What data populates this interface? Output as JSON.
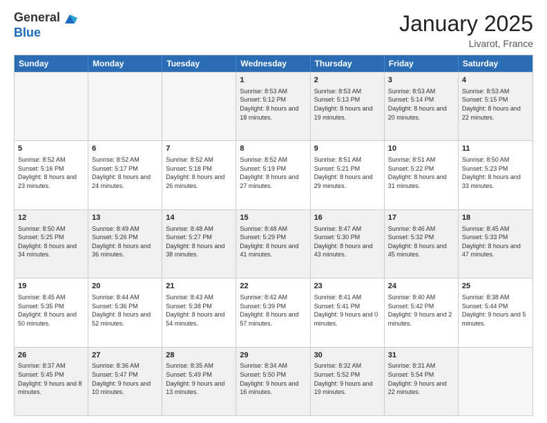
{
  "logo": {
    "general": "General",
    "blue": "Blue"
  },
  "header": {
    "month": "January 2025",
    "location": "Livarot, France"
  },
  "weekdays": [
    "Sunday",
    "Monday",
    "Tuesday",
    "Wednesday",
    "Thursday",
    "Friday",
    "Saturday"
  ],
  "weeks": [
    [
      {
        "day": "",
        "empty": true
      },
      {
        "day": "",
        "empty": true
      },
      {
        "day": "",
        "empty": true
      },
      {
        "day": "1",
        "rise": "8:53 AM",
        "set": "5:12 PM",
        "daylight": "8 hours and 18 minutes."
      },
      {
        "day": "2",
        "rise": "8:53 AM",
        "set": "5:13 PM",
        "daylight": "8 hours and 19 minutes."
      },
      {
        "day": "3",
        "rise": "8:53 AM",
        "set": "5:14 PM",
        "daylight": "8 hours and 20 minutes."
      },
      {
        "day": "4",
        "rise": "8:53 AM",
        "set": "5:15 PM",
        "daylight": "8 hours and 22 minutes."
      }
    ],
    [
      {
        "day": "5",
        "rise": "8:52 AM",
        "set": "5:16 PM",
        "daylight": "8 hours and 23 minutes."
      },
      {
        "day": "6",
        "rise": "8:52 AM",
        "set": "5:17 PM",
        "daylight": "8 hours and 24 minutes."
      },
      {
        "day": "7",
        "rise": "8:52 AM",
        "set": "5:18 PM",
        "daylight": "8 hours and 26 minutes."
      },
      {
        "day": "8",
        "rise": "8:52 AM",
        "set": "5:19 PM",
        "daylight": "8 hours and 27 minutes."
      },
      {
        "day": "9",
        "rise": "8:51 AM",
        "set": "5:21 PM",
        "daylight": "8 hours and 29 minutes."
      },
      {
        "day": "10",
        "rise": "8:51 AM",
        "set": "5:22 PM",
        "daylight": "8 hours and 31 minutes."
      },
      {
        "day": "11",
        "rise": "8:50 AM",
        "set": "5:23 PM",
        "daylight": "8 hours and 33 minutes."
      }
    ],
    [
      {
        "day": "12",
        "rise": "8:50 AM",
        "set": "5:25 PM",
        "daylight": "8 hours and 34 minutes."
      },
      {
        "day": "13",
        "rise": "8:49 AM",
        "set": "5:26 PM",
        "daylight": "8 hours and 36 minutes."
      },
      {
        "day": "14",
        "rise": "8:48 AM",
        "set": "5:27 PM",
        "daylight": "8 hours and 38 minutes."
      },
      {
        "day": "15",
        "rise": "8:48 AM",
        "set": "5:29 PM",
        "daylight": "8 hours and 41 minutes."
      },
      {
        "day": "16",
        "rise": "8:47 AM",
        "set": "5:30 PM",
        "daylight": "8 hours and 43 minutes."
      },
      {
        "day": "17",
        "rise": "8:46 AM",
        "set": "5:32 PM",
        "daylight": "8 hours and 45 minutes."
      },
      {
        "day": "18",
        "rise": "8:45 AM",
        "set": "5:33 PM",
        "daylight": "8 hours and 47 minutes."
      }
    ],
    [
      {
        "day": "19",
        "rise": "8:45 AM",
        "set": "5:35 PM",
        "daylight": "8 hours and 50 minutes."
      },
      {
        "day": "20",
        "rise": "8:44 AM",
        "set": "5:36 PM",
        "daylight": "8 hours and 52 minutes."
      },
      {
        "day": "21",
        "rise": "8:43 AM",
        "set": "5:38 PM",
        "daylight": "8 hours and 54 minutes."
      },
      {
        "day": "22",
        "rise": "8:42 AM",
        "set": "5:39 PM",
        "daylight": "8 hours and 57 minutes."
      },
      {
        "day": "23",
        "rise": "8:41 AM",
        "set": "5:41 PM",
        "daylight": "9 hours and 0 minutes."
      },
      {
        "day": "24",
        "rise": "8:40 AM",
        "set": "5:42 PM",
        "daylight": "9 hours and 2 minutes."
      },
      {
        "day": "25",
        "rise": "8:38 AM",
        "set": "5:44 PM",
        "daylight": "9 hours and 5 minutes."
      }
    ],
    [
      {
        "day": "26",
        "rise": "8:37 AM",
        "set": "5:45 PM",
        "daylight": "9 hours and 8 minutes."
      },
      {
        "day": "27",
        "rise": "8:36 AM",
        "set": "5:47 PM",
        "daylight": "9 hours and 10 minutes."
      },
      {
        "day": "28",
        "rise": "8:35 AM",
        "set": "5:49 PM",
        "daylight": "9 hours and 13 minutes."
      },
      {
        "day": "29",
        "rise": "8:34 AM",
        "set": "5:50 PM",
        "daylight": "9 hours and 16 minutes."
      },
      {
        "day": "30",
        "rise": "8:32 AM",
        "set": "5:52 PM",
        "daylight": "9 hours and 19 minutes."
      },
      {
        "day": "31",
        "rise": "8:31 AM",
        "set": "5:54 PM",
        "daylight": "9 hours and 22 minutes."
      },
      {
        "day": "",
        "empty": true
      }
    ]
  ]
}
